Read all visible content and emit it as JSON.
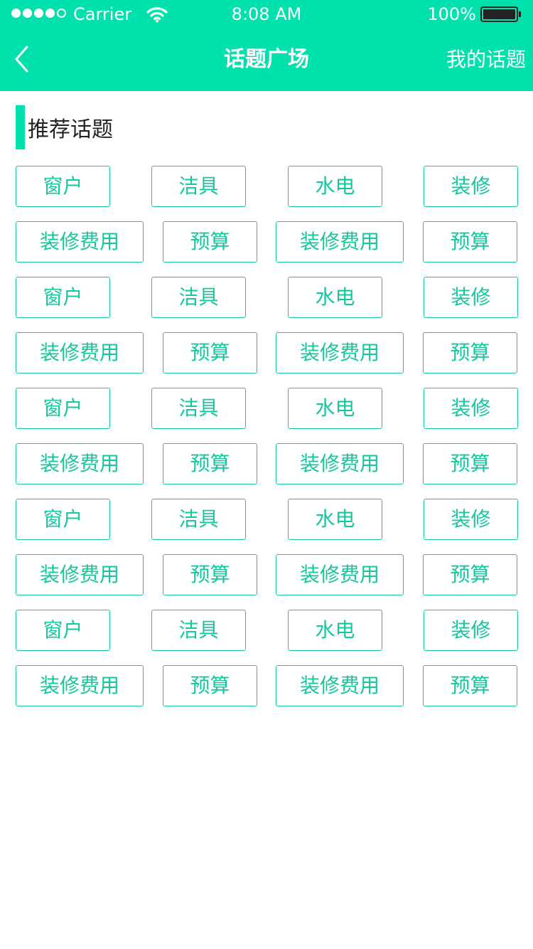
{
  "status_bar": {
    "carrier": "Carrier",
    "time": "8:08 AM",
    "battery": "100%"
  },
  "nav": {
    "title": "话题广场",
    "right_label": "我的话题",
    "back_icon": "chevron-left-icon"
  },
  "section": {
    "title": "推荐话题"
  },
  "tag_rows": [
    [
      "窗户",
      "洁具",
      "水电",
      "装修"
    ],
    [
      "装修费用",
      "预算",
      "装修费用",
      "预算"
    ],
    [
      "窗户",
      "洁具",
      "水电",
      "装修"
    ],
    [
      "装修费用",
      "预算",
      "装修费用",
      "预算"
    ],
    [
      "窗户",
      "洁具",
      "水电",
      "装修"
    ],
    [
      "装修费用",
      "预算",
      "装修费用",
      "预算"
    ],
    [
      "窗户",
      "洁具",
      "水电",
      "装修"
    ],
    [
      "装修费用",
      "预算",
      "装修费用",
      "预算"
    ],
    [
      "窗户",
      "洁具",
      "水电",
      "装修"
    ],
    [
      "装修费用",
      "预算",
      "装修费用",
      "预算"
    ]
  ],
  "colors": {
    "accent": "#00e2ad",
    "tag": "#14c79d"
  }
}
